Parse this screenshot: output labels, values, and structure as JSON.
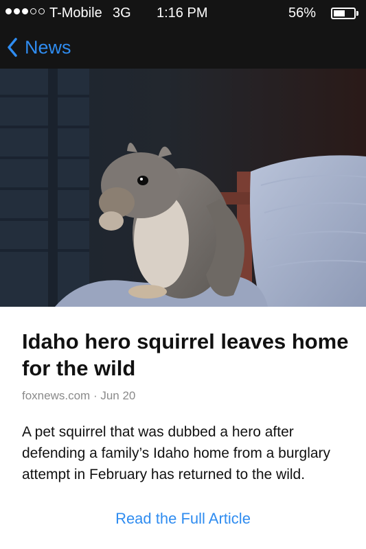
{
  "status_bar": {
    "signal_dots_filled": 3,
    "signal_dots_total": 5,
    "carrier": "T-Mobile",
    "network": "3G",
    "time": "1:16 PM",
    "battery_percent_label": "56%",
    "battery_level": 0.56
  },
  "nav": {
    "back_icon": "chevron-left-icon",
    "back_label": "News"
  },
  "article": {
    "image_subject": "squirrel",
    "title": "Idaho hero squirrel leaves home for the wild",
    "source": "foxnews.com",
    "separator": "·",
    "date": "Jun 20",
    "summary": "A pet squirrel that was dubbed a hero after defending a family’s Idaho home from a burglary attempt in February has returned to the wild.",
    "read_more_label": "Read the Full Article"
  },
  "colors": {
    "bar_background": "#141414",
    "accent": "#2f8cf0",
    "meta_text": "#8a8a8a"
  }
}
